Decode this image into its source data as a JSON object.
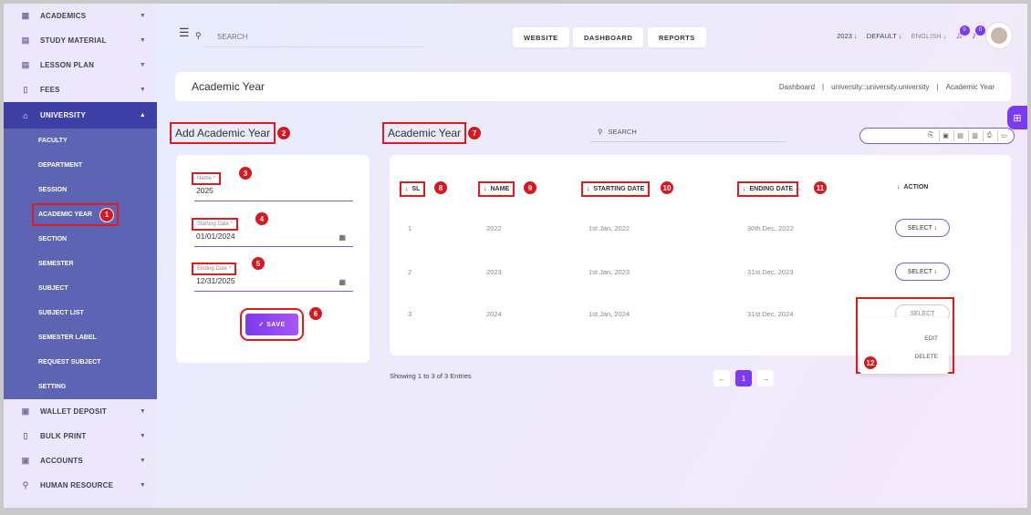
{
  "sidebar": {
    "items_top": [
      {
        "label": "ACADEMICS",
        "icon": "building-icon"
      },
      {
        "label": "STUDY MATERIAL",
        "icon": "book-icon"
      },
      {
        "label": "LESSON PLAN",
        "icon": "calendar-icon"
      },
      {
        "label": "FEES",
        "icon": "receipt-icon"
      }
    ],
    "active": {
      "label": "UNIVERSITY",
      "icon": "university-icon"
    },
    "sub_items": [
      "FACULTY",
      "DEPARTMENT",
      "SESSION",
      "ACADEMIC YEAR",
      "SECTION",
      "SEMESTER",
      "SUBJECT",
      "SUBJECT LIST",
      "SEMESTER LABEL",
      "REQUEST SUBJECT",
      "SETTING"
    ],
    "items_bottom": [
      {
        "label": "WALLET DEPOSIT",
        "icon": "wallet-icon"
      },
      {
        "label": "BULK PRINT",
        "icon": "print-icon"
      },
      {
        "label": "ACCOUNTS",
        "icon": "accounts-icon"
      },
      {
        "label": "HUMAN RESOURCE",
        "icon": "people-icon"
      }
    ]
  },
  "topbar": {
    "search_placeholder": "SEARCH",
    "buttons": [
      "WEBSITE",
      "DASHBOARD",
      "REPORTS"
    ],
    "year": "2023",
    "school": "DEFAULT",
    "language": "ENGLISH",
    "notif_badge_1": "0",
    "notif_badge_2": "0"
  },
  "titlebar": {
    "title": "Academic Year",
    "breadcrumb": [
      "Dashboard",
      "university::university.university",
      "Academic Year"
    ]
  },
  "form": {
    "title": "Add Academic Year",
    "name_label": "Name *",
    "name_value": "2025",
    "start_label": "Starting Date *",
    "start_value": "01/01/2024",
    "end_label": "Ending Date *",
    "end_value": "12/31/2025",
    "save_label": "✓ SAVE"
  },
  "list": {
    "title": "Academic Year",
    "search_placeholder": "SEARCH",
    "columns": [
      "SL",
      "NAME",
      "STARTING DATE",
      "ENDING DATE",
      "ACTION"
    ],
    "rows": [
      {
        "sl": "1",
        "name": "2022",
        "start": "1st Jan, 2022",
        "end": "30th Dec, 2022",
        "action": "SELECT ↓"
      },
      {
        "sl": "2",
        "name": "2023",
        "start": "1st Jan, 2023",
        "end": "31st Dec, 2023",
        "action": "SELECT ↓"
      },
      {
        "sl": "3",
        "name": "2024",
        "start": "1st Jan, 2024",
        "end": "31st Dec, 2024",
        "action": "SELECT"
      }
    ],
    "dropdown": [
      "EDIT",
      "DELETE"
    ],
    "footer": "Showing 1 to 3 of 3 Entries",
    "page": "1",
    "prev": "←",
    "next": "→"
  },
  "markers": [
    "1",
    "2",
    "3",
    "4",
    "5",
    "6",
    "7",
    "8",
    "9",
    "10",
    "11",
    "12"
  ]
}
